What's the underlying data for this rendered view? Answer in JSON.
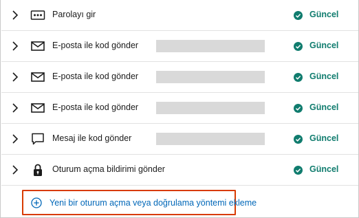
{
  "methods": [
    {
      "label": "Parolayı gir",
      "icon": "password-dots-icon",
      "redacted": false,
      "status": "Güncel"
    },
    {
      "label": "E-posta ile kod gönder",
      "icon": "envelope-icon",
      "redacted": true,
      "status": "Güncel"
    },
    {
      "label": "E-posta ile kod gönder",
      "icon": "envelope-icon",
      "redacted": true,
      "status": "Güncel"
    },
    {
      "label": "E-posta ile kod gönder",
      "icon": "envelope-icon",
      "redacted": true,
      "status": "Güncel"
    },
    {
      "label": "Mesaj ile kod gönder",
      "icon": "chat-bubble-icon",
      "redacted": true,
      "status": "Güncel"
    },
    {
      "label": "Oturum açma bildirimi gönder",
      "icon": "lock-icon",
      "redacted": false,
      "status": "Güncel"
    }
  ],
  "add_method": {
    "label": "Yeni bir oturum açma veya doğrulama yöntemi ekleme",
    "icon": "plus-circle-icon"
  },
  "colors": {
    "status": "#107c6e",
    "link": "#0067b8",
    "highlight": "#d83b01",
    "redaction": "#d9d9d9"
  }
}
